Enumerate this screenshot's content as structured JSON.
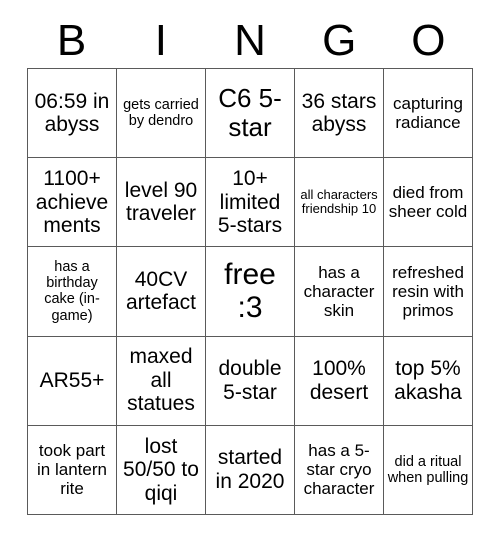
{
  "header": {
    "letters": [
      "B",
      "I",
      "N",
      "G",
      "O"
    ]
  },
  "board": {
    "rows": [
      [
        {
          "text": "06:59 in abyss",
          "size": "md"
        },
        {
          "text": "gets carried by dendro",
          "size": "xs"
        },
        {
          "text": "C6 5-star",
          "size": "lg"
        },
        {
          "text": "36 stars abyss",
          "size": "md"
        },
        {
          "text": "capturing radiance",
          "size": "sm"
        }
      ],
      [
        {
          "text": "1100+ achievements",
          "size": "md"
        },
        {
          "text": "level 90 traveler",
          "size": "md"
        },
        {
          "text": "10+ limited 5-stars",
          "size": "md"
        },
        {
          "text": "all characters friendship 10",
          "size": "xxs"
        },
        {
          "text": "died from sheer cold",
          "size": "sm"
        }
      ],
      [
        {
          "text": "has a birthday cake (in-game)",
          "size": "xs"
        },
        {
          "text": "40CV artefact",
          "size": "md"
        },
        {
          "text": "free :3",
          "size": "xl"
        },
        {
          "text": "has a character skin",
          "size": "sm"
        },
        {
          "text": "refreshed resin with primos",
          "size": "sm"
        }
      ],
      [
        {
          "text": "AR55+",
          "size": "md"
        },
        {
          "text": "maxed all statues",
          "size": "md"
        },
        {
          "text": "double 5-star",
          "size": "md"
        },
        {
          "text": "100% desert",
          "size": "md"
        },
        {
          "text": "top 5% akasha",
          "size": "md"
        }
      ],
      [
        {
          "text": "took part in lantern rite",
          "size": "sm"
        },
        {
          "text": "lost 50/50 to qiqi",
          "size": "md"
        },
        {
          "text": "started in 2020",
          "size": "md"
        },
        {
          "text": "has a 5-star cryo character",
          "size": "sm"
        },
        {
          "text": "did a ritual when pulling",
          "size": "xs"
        }
      ]
    ]
  },
  "colors": {
    "background": "#ffffff",
    "text": "#000000",
    "border": "#5a5a5a"
  }
}
